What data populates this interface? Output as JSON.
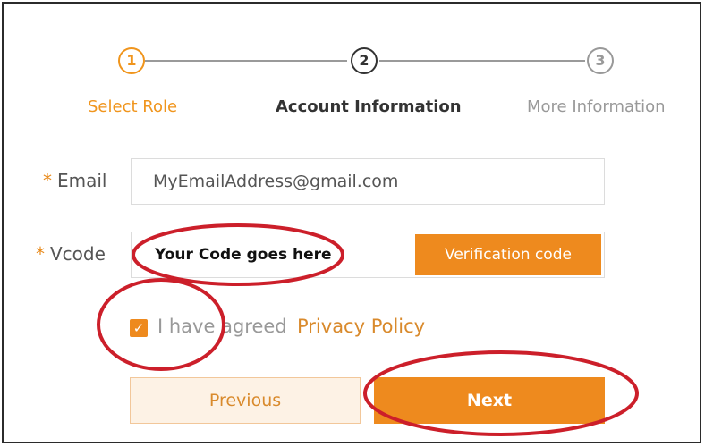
{
  "stepper": {
    "steps": [
      {
        "number": "1",
        "label": "Select Role",
        "state": "completed"
      },
      {
        "number": "2",
        "label": "Account Information",
        "state": "current"
      },
      {
        "number": "3",
        "label": "More Information",
        "state": "upcoming"
      }
    ]
  },
  "form": {
    "email": {
      "required_mark": "*",
      "label": "Email",
      "value": "MyEmailAddress@gmail.com"
    },
    "vcode": {
      "required_mark": "*",
      "label": "Vcode",
      "value": "Your Code goes here",
      "button_label": "Verification code"
    },
    "agreement": {
      "checked": true,
      "checkmark": "✓",
      "text": "I have agreed",
      "link_label": "Privacy Policy"
    }
  },
  "buttons": {
    "previous_label": "Previous",
    "next_label": "Next"
  },
  "colors": {
    "accent": "#ee8a1e",
    "annotation": "#cc1f2a"
  }
}
